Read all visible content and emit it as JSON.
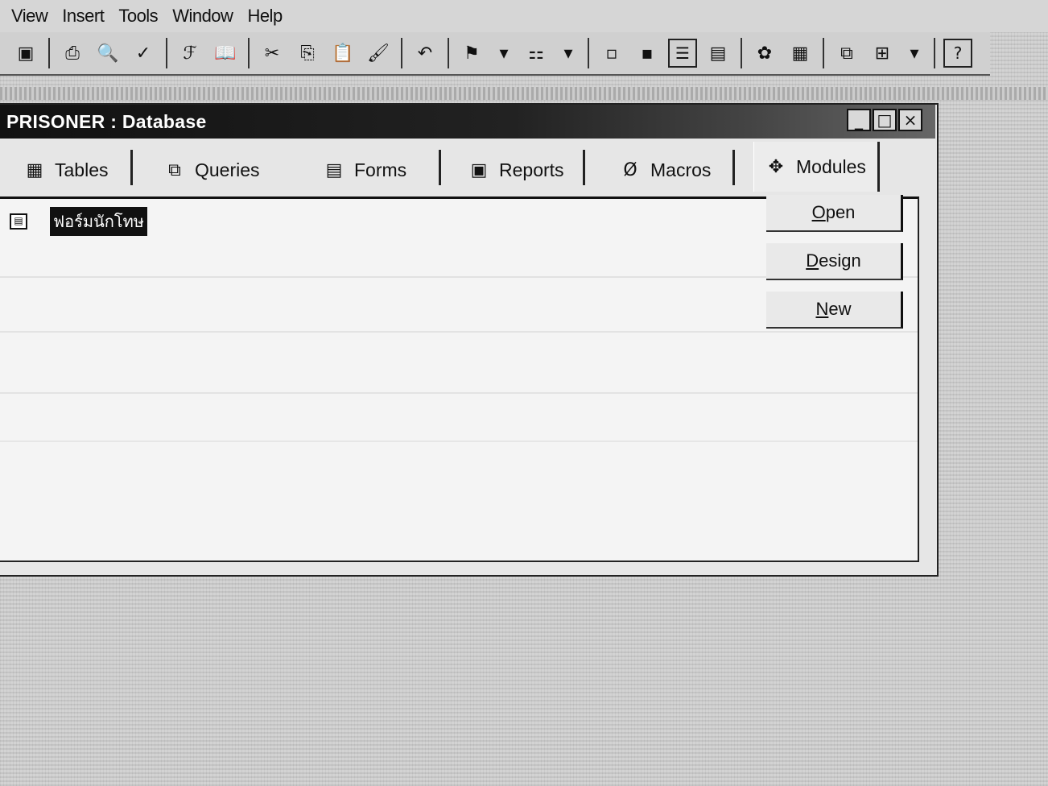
{
  "menu": {
    "items": [
      {
        "label": "View"
      },
      {
        "label": "Insert"
      },
      {
        "label": "Tools"
      },
      {
        "label": "Window"
      },
      {
        "label": "Help"
      }
    ]
  },
  "toolbar": {
    "buttons": [
      {
        "name": "save-icon",
        "glyph": "▣"
      },
      {
        "name": "print-icon",
        "glyph": "⎙"
      },
      {
        "name": "print-preview-icon",
        "glyph": "🔍"
      },
      {
        "name": "spelling-icon",
        "glyph": "✓"
      },
      {
        "name": "format-painter-icon",
        "glyph": "ℱ"
      },
      {
        "name": "book-icon",
        "glyph": "📖"
      },
      {
        "name": "cut-icon",
        "glyph": "✂"
      },
      {
        "name": "copy-icon",
        "glyph": "⎘"
      },
      {
        "name": "paste-icon",
        "glyph": "📋"
      },
      {
        "name": "brush-icon",
        "glyph": "🖌"
      },
      {
        "name": "undo-icon",
        "glyph": "↶"
      },
      {
        "name": "office-links-icon",
        "glyph": "⚑"
      },
      {
        "name": "analyze-icon",
        "glyph": "⚏"
      },
      {
        "name": "large-icons-icon",
        "glyph": "▫"
      },
      {
        "name": "small-icons-icon",
        "glyph": "▪"
      },
      {
        "name": "list-view-icon",
        "glyph": "☰"
      },
      {
        "name": "details-view-icon",
        "glyph": "▤"
      },
      {
        "name": "code-icon",
        "glyph": "✿"
      },
      {
        "name": "properties-icon",
        "glyph": "▦"
      },
      {
        "name": "relationships-icon",
        "glyph": "⧉"
      },
      {
        "name": "new-object-icon",
        "glyph": "⊞"
      },
      {
        "name": "help-icon",
        "glyph": "?"
      }
    ]
  },
  "window": {
    "title": "PRISONER : Database",
    "minimize": "_",
    "maximize": "□",
    "close": "×"
  },
  "tabs": [
    {
      "label": "Tables",
      "icon": "table-icon",
      "glyph": "▦"
    },
    {
      "label": "Queries",
      "icon": "query-icon",
      "glyph": "⧉"
    },
    {
      "label": "Forms",
      "icon": "form-icon",
      "glyph": "▤"
    },
    {
      "label": "Reports",
      "icon": "report-icon",
      "glyph": "▣"
    },
    {
      "label": "Macros",
      "icon": "macro-icon",
      "glyph": "Ø"
    },
    {
      "label": "Modules",
      "icon": "module-icon",
      "glyph": "✥"
    }
  ],
  "active_tab": "Modules",
  "objects": [
    {
      "label": "ฟอร์มนักโทษ",
      "icon": "form-icon",
      "selected": true
    }
  ],
  "actions": {
    "open": {
      "first": "O",
      "rest": "pen"
    },
    "design": {
      "first": "D",
      "rest": "esign"
    },
    "new": {
      "first": "N",
      "rest": "ew"
    }
  }
}
